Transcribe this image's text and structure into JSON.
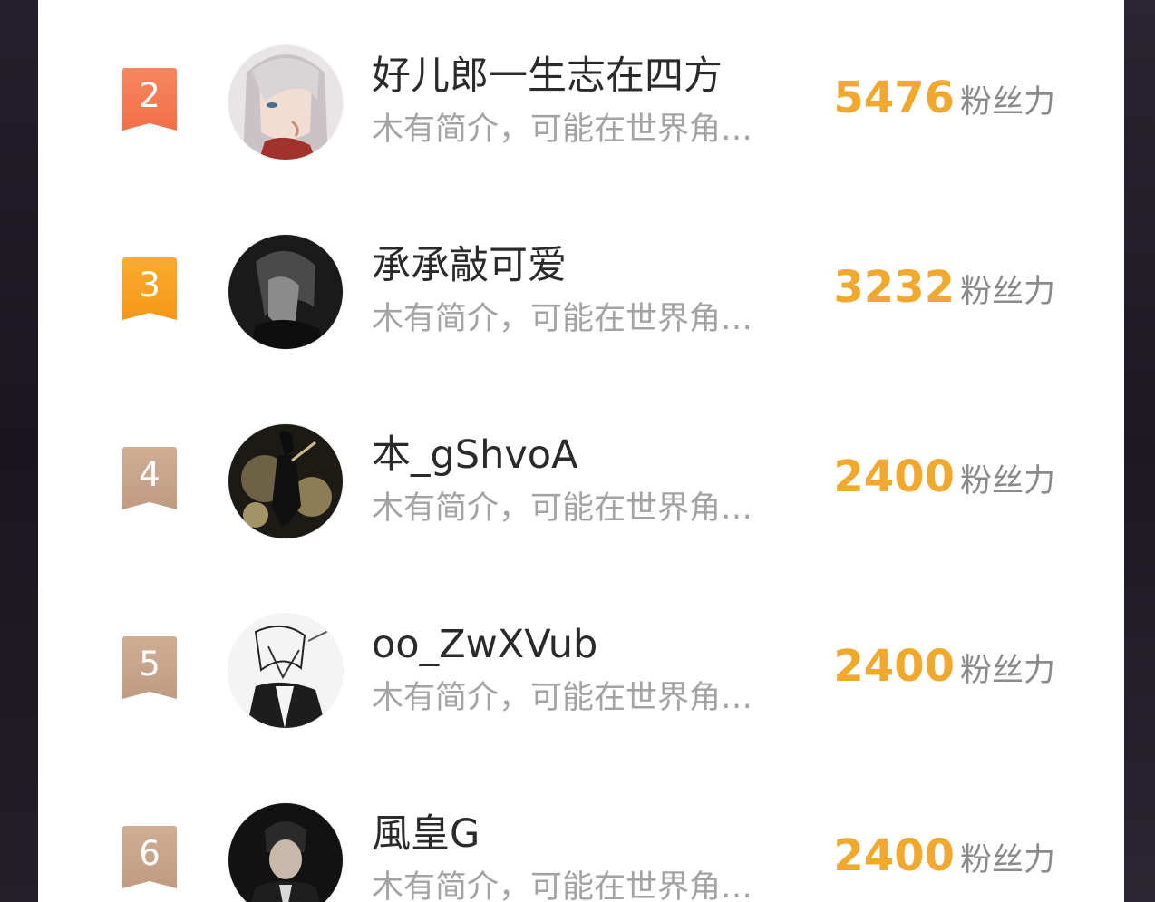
{
  "leaderboard": {
    "rows": [
      {
        "rank": "2",
        "name": "好儿郎一生志在四方",
        "bio": "木有简介，可能在世界角…",
        "score": "5476",
        "unit": "粉丝力",
        "badge_color": "#f47a52",
        "avatar": "avatar-white-hair-portrait"
      },
      {
        "rank": "3",
        "name": "承承敲可爱",
        "bio": "木有简介，可能在世界角…",
        "score": "3232",
        "unit": "粉丝力",
        "badge_color": "#f7a11f",
        "avatar": "avatar-dark-portrait"
      },
      {
        "rank": "4",
        "name": "本_gShvoA",
        "bio": "木有简介，可能在世界角…",
        "score": "2400",
        "unit": "粉丝力",
        "badge_color": "#c7a48b",
        "avatar": "avatar-dark-gold-figure"
      },
      {
        "rank": "5",
        "name": "oo_ZwXVub",
        "bio": "木有简介，可能在世界角…",
        "score": "2400",
        "unit": "粉丝力",
        "badge_color": "#c7a48b",
        "avatar": "avatar-sketch-portrait"
      },
      {
        "rank": "6",
        "name": "風皇G",
        "bio": "木有简介，可能在世界角…",
        "score": "2400",
        "unit": "粉丝力",
        "badge_color": "#c7a48b",
        "avatar": "avatar-suit-portrait"
      }
    ]
  }
}
